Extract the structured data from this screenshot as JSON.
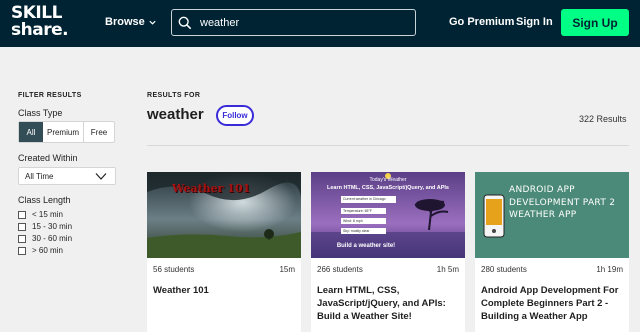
{
  "header": {
    "logo_line1": "SKILL",
    "logo_line2": "share.",
    "browse_label": "Browse",
    "search_value": "weather",
    "search_placeholder": "",
    "go_premium_label": "Go Premium",
    "sign_in_label": "Sign In",
    "sign_up_label": "Sign Up",
    "sign_up_color": "#00ff84",
    "bar_color": "#002333"
  },
  "filters": {
    "title": "FILTER RESULTS",
    "class_type": {
      "label": "Class Type",
      "options": [
        "All",
        "Premium",
        "Free"
      ],
      "selected": "All"
    },
    "created_within": {
      "label": "Created Within",
      "selected": "All Time"
    },
    "class_length": {
      "label": "Class Length",
      "options": [
        "< 15 min",
        "15 - 30 min",
        "30 - 60 min",
        "> 60 min"
      ]
    }
  },
  "results": {
    "heading": "RESULTS FOR",
    "query": "weather",
    "follow_label": "Follow",
    "count_text": "322 Results",
    "accent_color": "#3a2bd9"
  },
  "cards": [
    {
      "thumb_text": "Weather 101",
      "students": "56 students",
      "duration": "15m",
      "title": "Weather 101"
    },
    {
      "thumb_title": "Today's Weather",
      "thumb_subtitle": "Learn HTML, CSS, JavaScript/jQuery, and APIs",
      "thumb_field1": "Current weather in Chicago",
      "thumb_field2": "Temperature: 65°F",
      "thumb_field3": "Wind: 8 mph",
      "thumb_field4": "Sky: mostly clear",
      "thumb_cta": "Build a weather site!",
      "students": "266 students",
      "duration": "1h 5m",
      "title": "Learn HTML, CSS, JavaScript/jQuery, and APIs: Build a Weather Site!"
    },
    {
      "thumb_text": "ANDROID APP DEVELOPMENT PART 2 WEATHER APP",
      "students": "280 students",
      "duration": "1h 19m",
      "title": "Android App Development For Complete Beginners Part 2 - Building a Weather App"
    }
  ]
}
